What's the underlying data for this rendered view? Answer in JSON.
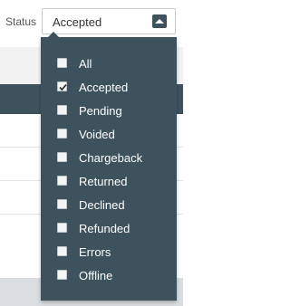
{
  "filter": {
    "label": "Status",
    "selected": "Accepted",
    "caret_icon": "caret-up-icon"
  },
  "dropdown": {
    "options": [
      {
        "label": "All",
        "checked": false
      },
      {
        "label": "Accepted",
        "checked": true
      },
      {
        "label": "Pending",
        "checked": false
      },
      {
        "label": "Voided",
        "checked": false
      },
      {
        "label": "Chargeback",
        "checked": false
      },
      {
        "label": "Returned",
        "checked": false
      },
      {
        "label": "Declined",
        "checked": false
      },
      {
        "label": "Refunded",
        "checked": false
      },
      {
        "label": "Errors",
        "checked": false
      },
      {
        "label": "Offline",
        "checked": false
      }
    ]
  },
  "colors": {
    "menu_bg": "#3e525d",
    "menu_text": "#ffffff"
  }
}
